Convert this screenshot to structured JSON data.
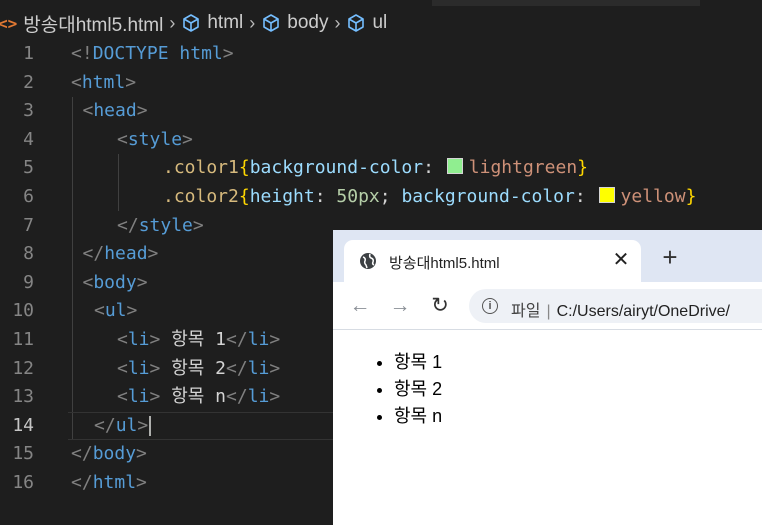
{
  "editor": {
    "breadcrumb": {
      "file_icon": "<>",
      "file": "방송대html5.html",
      "items": [
        "html",
        "body",
        "ul"
      ]
    },
    "active_line": 14,
    "lines": [
      {
        "n": "1",
        "indent": 0,
        "tokens": [
          [
            "punc",
            "<!"
          ],
          [
            "tag",
            "DOCTYPE "
          ],
          [
            "tag",
            "html"
          ],
          [
            "punc",
            ">"
          ]
        ]
      },
      {
        "n": "2",
        "indent": 0,
        "tokens": [
          [
            "punc",
            "<"
          ],
          [
            "tag",
            "html"
          ],
          [
            "punc",
            ">"
          ]
        ]
      },
      {
        "n": "3",
        "indent": 1,
        "tokens": [
          [
            "punc",
            "<"
          ],
          [
            "tag",
            "head"
          ],
          [
            "punc",
            ">"
          ]
        ]
      },
      {
        "n": "4",
        "indent": 4,
        "tokens": [
          [
            "punc",
            "<"
          ],
          [
            "tag",
            "style"
          ],
          [
            "punc",
            ">"
          ]
        ]
      },
      {
        "n": "5",
        "indent": 8,
        "tokens": [
          [
            "sel",
            ".color1"
          ],
          [
            "brace",
            "{"
          ],
          [
            "prop",
            "background-color"
          ],
          [
            "text",
            ": "
          ],
          [
            "swatch",
            "#90ee90"
          ],
          [
            "val",
            "lightgreen"
          ],
          [
            "brace",
            "}"
          ]
        ]
      },
      {
        "n": "6",
        "indent": 8,
        "tokens": [
          [
            "sel",
            ".color2"
          ],
          [
            "brace",
            "{"
          ],
          [
            "prop",
            "height"
          ],
          [
            "text",
            ": "
          ],
          [
            "num",
            "50px"
          ],
          [
            "text",
            "; "
          ],
          [
            "prop",
            "background-color"
          ],
          [
            "text",
            ": "
          ],
          [
            "swatch",
            "#ffff00"
          ],
          [
            "val",
            "yellow"
          ],
          [
            "brace",
            "}"
          ]
        ]
      },
      {
        "n": "7",
        "indent": 4,
        "tokens": [
          [
            "punc",
            "</"
          ],
          [
            "tag",
            "style"
          ],
          [
            "punc",
            ">"
          ]
        ]
      },
      {
        "n": "8",
        "indent": 1,
        "tokens": [
          [
            "punc",
            "</"
          ],
          [
            "tag",
            "head"
          ],
          [
            "punc",
            ">"
          ]
        ]
      },
      {
        "n": "9",
        "indent": 1,
        "tokens": [
          [
            "punc",
            "<"
          ],
          [
            "tag",
            "body"
          ],
          [
            "punc",
            ">"
          ]
        ]
      },
      {
        "n": "10",
        "indent": 2,
        "tokens": [
          [
            "punc",
            "<"
          ],
          [
            "tag",
            "ul"
          ],
          [
            "punc",
            ">"
          ]
        ]
      },
      {
        "n": "11",
        "indent": 4,
        "tokens": [
          [
            "punc",
            "<"
          ],
          [
            "tag",
            "li"
          ],
          [
            "punc",
            "> "
          ],
          [
            "text",
            "항목 1"
          ],
          [
            "punc",
            "</"
          ],
          [
            "tag",
            "li"
          ],
          [
            "punc",
            ">"
          ]
        ]
      },
      {
        "n": "12",
        "indent": 4,
        "tokens": [
          [
            "punc",
            "<"
          ],
          [
            "tag",
            "li"
          ],
          [
            "punc",
            "> "
          ],
          [
            "text",
            "항목 2"
          ],
          [
            "punc",
            "</"
          ],
          [
            "tag",
            "li"
          ],
          [
            "punc",
            ">"
          ]
        ]
      },
      {
        "n": "13",
        "indent": 4,
        "tokens": [
          [
            "punc",
            "<"
          ],
          [
            "tag",
            "li"
          ],
          [
            "punc",
            "> "
          ],
          [
            "text",
            "항목 n"
          ],
          [
            "punc",
            "</"
          ],
          [
            "tag",
            "li"
          ],
          [
            "punc",
            ">"
          ]
        ]
      },
      {
        "n": "14",
        "indent": 2,
        "tokens": [
          [
            "punc",
            "</"
          ],
          [
            "tag",
            "ul"
          ],
          [
            "punc",
            ">"
          ]
        ]
      },
      {
        "n": "15",
        "indent": 0,
        "tokens": [
          [
            "punc",
            "</"
          ],
          [
            "tag",
            "body"
          ],
          [
            "punc",
            ">"
          ]
        ]
      },
      {
        "n": "16",
        "indent": 0,
        "tokens": [
          [
            "punc",
            "</"
          ],
          [
            "tag",
            "html"
          ],
          [
            "punc",
            ">"
          ]
        ]
      }
    ]
  },
  "browser": {
    "tab": {
      "favicon": "globe-icon",
      "title": "방송대html5.html",
      "close": "✕"
    },
    "new_tab": "+",
    "nav": {
      "back": "←",
      "forward": "→",
      "reload": "↻"
    },
    "omnibox": {
      "info": "i",
      "label": "파일",
      "separator": "|",
      "url": "C:/Users/airyt/OneDrive/"
    },
    "list_items": [
      "항목 1",
      "항목 2",
      "항목 n"
    ]
  }
}
